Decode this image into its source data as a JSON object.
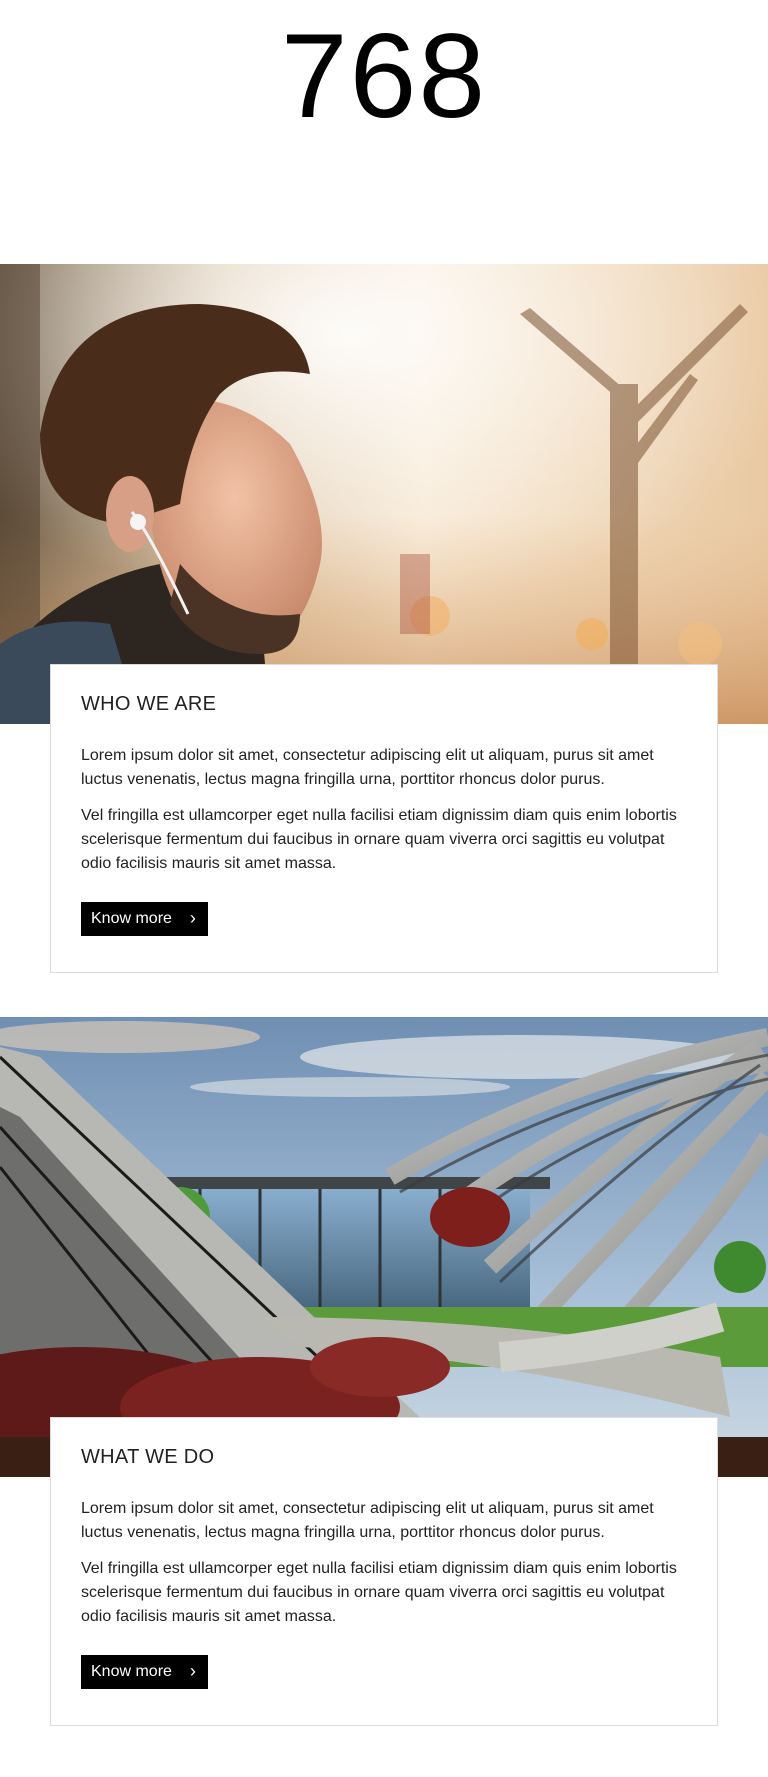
{
  "header": {
    "number": "768"
  },
  "sections": [
    {
      "title": "WHO WE ARE",
      "paragraphs": [
        "Lorem ipsum dolor sit amet, consectetur adipiscing elit ut aliquam, purus sit amet luctus venenatis, lectus magna fringilla urna, porttitor rhoncus dolor purus.",
        "Vel fringilla est ullamcorper eget nulla facilisi etiam dignissim diam quis enim lobortis scelerisque fermentum dui faucibus in ornare quam viverra orci sagittis eu volutpat odio facilisis mauris sit amet massa."
      ],
      "button_label": "Know more",
      "button_icon": "chevron-right-icon"
    },
    {
      "title": "WHAT WE DO",
      "paragraphs": [
        "Lorem ipsum dolor sit amet, consectetur adipiscing elit ut aliquam, purus sit amet luctus venenatis, lectus magna fringilla urna, porttitor rhoncus dolor purus.",
        "Vel fringilla est ullamcorper eget nulla facilisi etiam dignissim diam quis enim lobortis scelerisque fermentum dui faucibus in ornare quam viverra orci sagittis eu volutpat odio facilisis mauris sit amet massa."
      ],
      "button_label": "Know more",
      "button_icon": "chevron-right-icon"
    }
  ]
}
